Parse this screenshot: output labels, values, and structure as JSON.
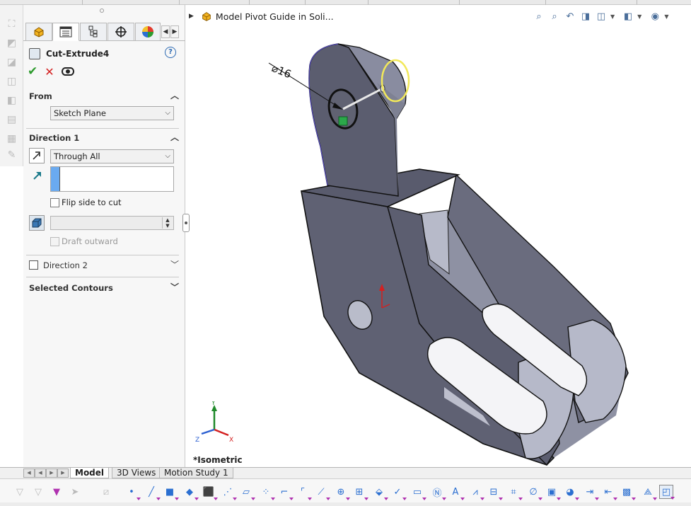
{
  "property_manager": {
    "feature_name": "Cut-Extrude4",
    "help_label": "?",
    "from": {
      "header": "From",
      "value": "Sketch Plane"
    },
    "direction1": {
      "header": "Direction 1",
      "end_condition": "Through All",
      "flip_label": "Flip side to cut",
      "draft_label": "Draft outward"
    },
    "direction2": {
      "header": "Direction 2"
    },
    "selected_contours": {
      "header": "Selected Contours"
    }
  },
  "viewport": {
    "breadcrumb": "Model Pivot Guide in Soli...",
    "view_label": "*Isometric",
    "dimension_text": "⌀16",
    "triad": {
      "x": "X",
      "y": "Y",
      "z": "Z"
    }
  },
  "bottom_tabs": [
    "Model",
    "3D Views",
    "Motion Study 1"
  ],
  "colors": {
    "part_face": "#5f6173",
    "part_face_light": "#9ea1b3",
    "part_face_top": "#8b8ea0",
    "selection_yellow": "#f2e85a",
    "accent_blue": "#2d6ab3"
  }
}
